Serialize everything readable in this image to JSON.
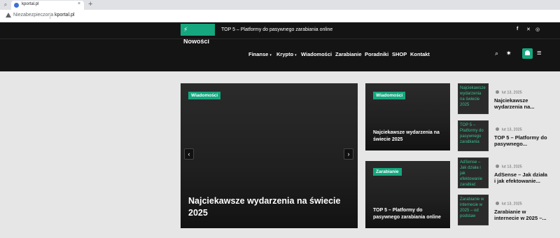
{
  "browser": {
    "tab_title": "kportal.pl",
    "tab_close": "×",
    "new_tab": "+",
    "security_label": "Niezabezpieczona",
    "url": "kportal.pl"
  },
  "ticker": {
    "badge": "⚡ Nowości",
    "text": "TOP 5 – Platformy do pasywnego zarabiania online"
  },
  "social": {
    "facebook": "f",
    "x": "✕",
    "instagram": "◎"
  },
  "nav": {
    "items": [
      {
        "label": "Finanse",
        "dropdown": true
      },
      {
        "label": "Krypto",
        "dropdown": true
      },
      {
        "label": "Wiadomości"
      },
      {
        "label": "Zarabianie"
      },
      {
        "label": "Poradniki"
      },
      {
        "label": "SHOP"
      },
      {
        "label": "Kontakt"
      }
    ],
    "caret": "▾",
    "icons": {
      "search": "⌕",
      "theme": "✷",
      "menu": "≡"
    }
  },
  "featured": {
    "badge": "Wiadomości",
    "title": "Najciekawsze wydarzenia na świecie 2025",
    "prev": "‹",
    "next": "›"
  },
  "mid_cards": [
    {
      "badge": "Wiadomości",
      "title": "Najciekawsze wydarzenia na świecie 2025"
    },
    {
      "badge": "Zarabianie",
      "title": "TOP 5 – Platformy do pasywnego zarabiania online"
    }
  ],
  "side_posts": [
    {
      "alt": "Najciekawsze wydarzenia na świecie 2025",
      "date": "lut 13, 2025",
      "title": "Najciekawsze wydarzenia na..."
    },
    {
      "alt": "TOP 5 – Platformy do pasywnego zarabiania",
      "date": "lut 13, 2025",
      "title": "TOP 5 – Platformy do pasywnego..."
    },
    {
      "alt": "AdSense – Jak działa i jak efektowanie zarabiać",
      "date": "lut 13, 2025",
      "title": "AdSense – Jak działa i jak efektowanie..."
    },
    {
      "alt": "Zarabianie w internecie w 2025 – od podstaw",
      "date": "lut 13, 2025",
      "title": "Zarabianie w internecie w 2025 –..."
    }
  ],
  "colors": {
    "accent": "#16a77f",
    "header": "#141414",
    "page_bg": "#e6e6e6"
  }
}
